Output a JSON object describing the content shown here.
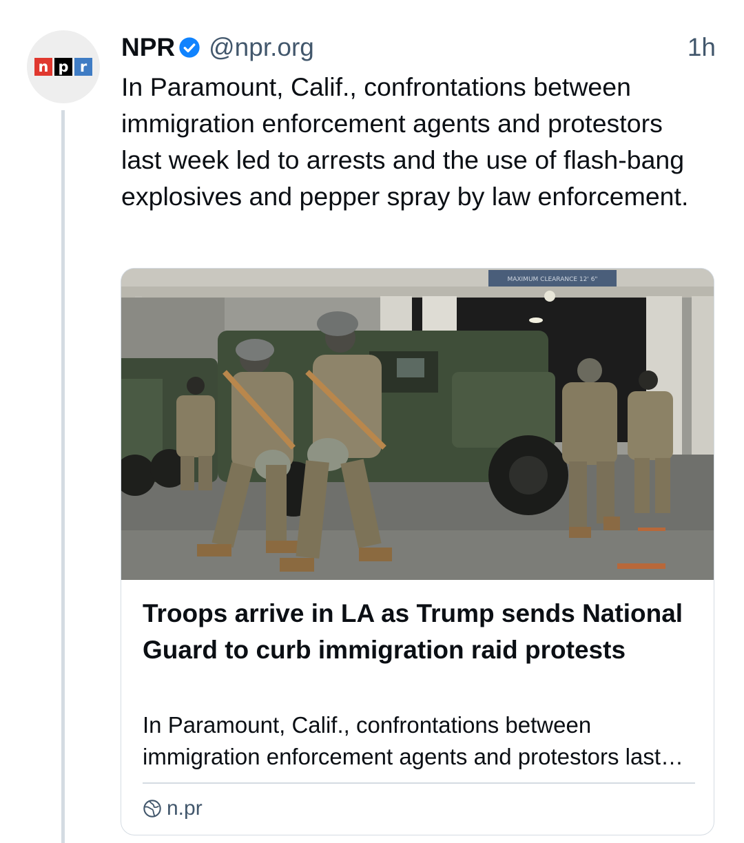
{
  "post": {
    "display_name": "NPR",
    "handle": "@npr.org",
    "timestamp": "1h",
    "text": "In Paramount, Calif., confrontations between immigration enforcement agents and protestors last week led to arrests and the use of flash-bang explosives and pepper spray by law enforcement.",
    "avatar_logo": [
      "n",
      "p",
      "r"
    ],
    "verified": true
  },
  "link_card": {
    "title": "Troops arrive in LA as Trump sends National Guard to curb immigration raid protests",
    "description": "In Paramount, Calif., confrontations between immigration enforcement agents and protestors last week led to arrests and the use of flash-bang explosives and pepper spray by law enforcement.",
    "domain": "n.pr",
    "image_sign_text": "MAXIMUM CLEARANCE 12' 6\""
  },
  "icons": {
    "verified": "verified-badge-icon",
    "domain": "globe-icon"
  },
  "colors": {
    "text": "#0b0f14",
    "muted": "#42576c",
    "border": "#d4dbe2",
    "verified": "#1083fe",
    "npr_red": "#e0382f",
    "npr_black": "#000000",
    "npr_blue": "#3f7cc4"
  }
}
